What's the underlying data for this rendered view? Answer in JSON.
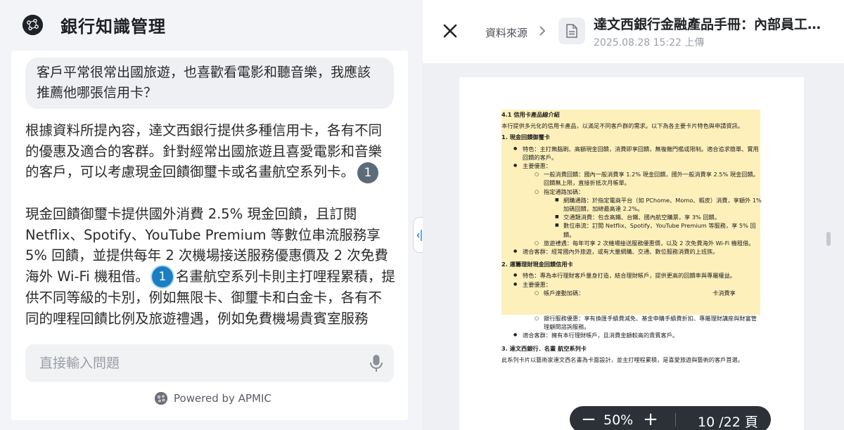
{
  "app": {
    "title": "銀行知識管理"
  },
  "chat": {
    "user_message": "客戶平常很常出國旅遊，也喜歡看電影和聽音樂，我應該推薦他哪張信用卡？",
    "answer_p1": "根據資料所提內容，達文西銀行提供多種信用卡，各有不同的優惠及適合的客群。針對經常出國旅遊且喜愛電影和音樂的客戶，可以考慮現金回饋御璽卡或名畫航空系列卡。",
    "citation_1": "1",
    "answer_p2a": "現金回饋御璽卡提供國外消費 2.5% 現金回饋，且訂閱 Netflix、Spotify、YouTube Premium 等數位串流服務享 5% 回饋，並提供每年 2 次機場接送服務優惠價及 2 次免費海外 Wi-Fi 機租借。",
    "citation_2": "1",
    "answer_p2b": "名畫航空系列卡則主打哩程累積，提供不同等級的卡別，例如無限卡、御璽卡和白金卡，各有不同的哩程回饋比例及旅遊禮遇，例如免費機場貴賓室服務",
    "input_placeholder": "直接輸入問題",
    "powered_by": "Powered by APMIC"
  },
  "viewer": {
    "breadcrumb": "資料來源",
    "doc_title": "達文西銀行金融產品手冊：內部員工專用版",
    "doc_meta": "2025.08.28 15:22 上傳",
    "zoom": "50%",
    "page_current": "10",
    "page_total": "/22 頁",
    "zoom_out": "−",
    "zoom_in": "+"
  },
  "pdf": {
    "h1": "4.1 信用卡產品線介紹",
    "intro": "本行提供多元化的信用卡產品，以滿足不同客戶群的需求。以下為各主要卡片特色與申請資訊。",
    "card1_title": "1. 現金回饋御璽卡",
    "c1_feature": "特色：主打無腦刷、高額現金回饋，消費即享回饋，無複雜門檻或限制。適合追求簡單、實用回饋的客戶。",
    "c1_main": "主要優惠：",
    "c1_general": "一般消費回饋：國內一般消費享 1.2% 現金回饋，國外一般消費享 2.5% 現金回饋。回饋無上限，直接折抵次月帳單。",
    "c1_channel": "指定通路加碼：",
    "c1_online": "網購通路：於指定電商平台（如 PChome、Momo、蝦皮）消費，享額外 1% 加碼回饋，加總最高達 2.2%。",
    "c1_transport": "交通類消費：包含高鐵、台鐵、國內航空購票，享 3% 回饋。",
    "c1_stream": "數位串流：訂閱 Netflix、Spotify、YouTube Premium 等服務，享 5% 回饋。",
    "c1_travel": "旅遊禮遇：每年可享 2 次機場接送服務優惠價，以及 2 次免費海外 Wi-Fi 機租借。",
    "c1_target": "適合客群：經常國內外旅遊，或有大量網購、交通、數位服務消費的上班族。",
    "card2_title": "2. 運籌理財現金回饋信用卡",
    "c2_feature": "特色：專為本行理財客戶量身打造，結合理財帳戶，提供更高的回饋率與專屬權益。",
    "c2_main": "主要優惠：",
    "c2_link": "帳戶連動加碼：",
    "c2_link_tail": "卡消費享",
    "c2_service": "銀行服務優惠：享有換匯手續費減免、基金申購手續費折扣、專屬理財講座與財富管理顧問諮詢服務。",
    "c2_target": "適合客群：擁有本行理財帳戶，且消費金額較高的貴賓客戶。",
    "card3_title": "3. 達文西銀行．名畫 航空系列卡",
    "c3_intro": "此系列卡片以藝術家達文西名畫為卡面設計，並主打哩程累積，是喜愛旅遊與藝術的客戶首選。"
  }
}
